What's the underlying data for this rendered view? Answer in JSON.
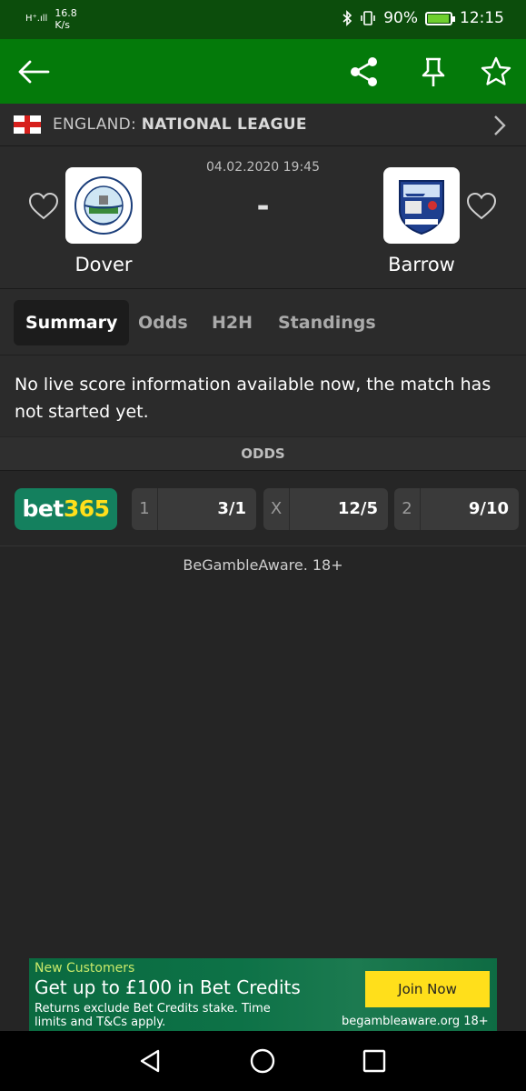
{
  "status_bar": {
    "signal": "H⁺.ıll",
    "speed_value": "16.8",
    "speed_unit": "K/s",
    "battery": "90%",
    "battery_level": 0.9,
    "time": "12:15"
  },
  "app_bar": {
    "back_icon": "arrow-left",
    "share_icon": "share",
    "pin_icon": "pin",
    "favorite_icon": "star-outline"
  },
  "league": {
    "country": "ENGLAND:",
    "name": "NATIONAL LEAGUE"
  },
  "match": {
    "datetime": "04.02.2020 19:45",
    "score": "-",
    "home": {
      "name": "Dover"
    },
    "away": {
      "name": "Barrow"
    }
  },
  "tabs": [
    {
      "label": "Summary",
      "active": true
    },
    {
      "label": "Odds",
      "active": false
    },
    {
      "label": "H2H",
      "active": false
    },
    {
      "label": "Standings",
      "active": false
    }
  ],
  "info_text": "No live score information available now, the match has not started yet.",
  "odds": {
    "header": "ODDS",
    "bookmaker_part1": "bet",
    "bookmaker_part2": "365",
    "cells": [
      {
        "label": "1",
        "value": "3/1"
      },
      {
        "label": "X",
        "value": "12/5"
      },
      {
        "label": "2",
        "value": "9/10"
      }
    ]
  },
  "gamble_notice": "BeGambleAware. 18+",
  "ad": {
    "top": "New Customers",
    "title": "Get up to £100 in Bet Credits",
    "small": "Returns exclude Bet Credits stake. Time limits and T&Cs apply.",
    "cta": "Join Now",
    "aware": "begambleaware.org  18+"
  },
  "colors": {
    "app_bar": "#047a0a",
    "status_bar": "#0c4d0c",
    "background": "#252525",
    "bet365_green": "#14805e",
    "bet365_yellow": "#ffdf1b"
  }
}
